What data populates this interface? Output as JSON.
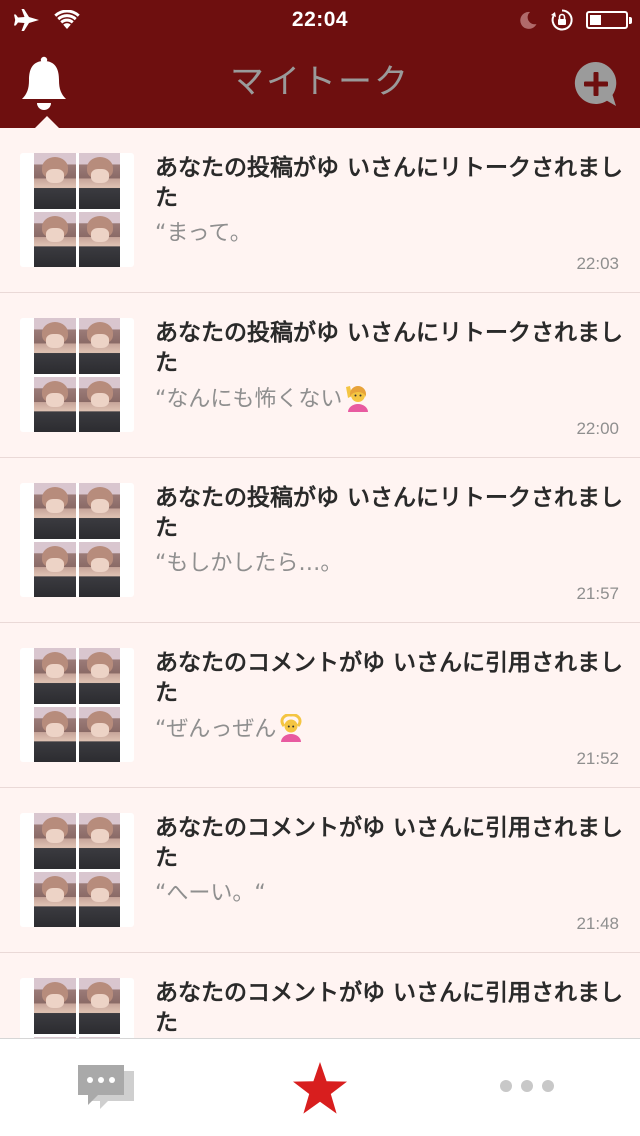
{
  "status_bar": {
    "time": "22:04",
    "battery_level": 0.33
  },
  "nav": {
    "title": "マイトーク"
  },
  "colors": {
    "bar_background": "#6e0f0f",
    "list_background": "#fff4f2",
    "accent_star": "#d81e1e",
    "muted_text": "#8f8f8f"
  },
  "notifications": [
    {
      "title": "あなたの投稿がゆ いさんにリトークされました",
      "quote": "“まって。",
      "emoji": "",
      "time": "22:03"
    },
    {
      "title": "あなたの投稿がゆ いさんにリトークされました",
      "quote": "“なんにも怖くない",
      "emoji": "person-raising-hand-emoji",
      "time": "22:00"
    },
    {
      "title": "あなたの投稿がゆ いさんにリトークされました",
      "quote": "“もしかしたら…。",
      "emoji": "",
      "time": "21:57"
    },
    {
      "title": "あなたのコメントがゆ いさんに引用されました",
      "quote": "“ぜんっぜん",
      "emoji": "person-gesturing-ok-emoji",
      "time": "21:52"
    },
    {
      "title": "あなたのコメントがゆ いさんに引用されました",
      "quote": "“へーい。“",
      "emoji": "",
      "time": "21:48"
    },
    {
      "title": "あなたのコメントがゆ いさんに引用されました",
      "quote": "",
      "emoji": "",
      "time": ""
    }
  ],
  "tab_bar": {
    "tabs": [
      {
        "icon": "chat-bubbles-icon",
        "selected": false
      },
      {
        "icon": "star-icon",
        "selected": true
      },
      {
        "icon": "more-dots-icon",
        "selected": false
      }
    ]
  }
}
